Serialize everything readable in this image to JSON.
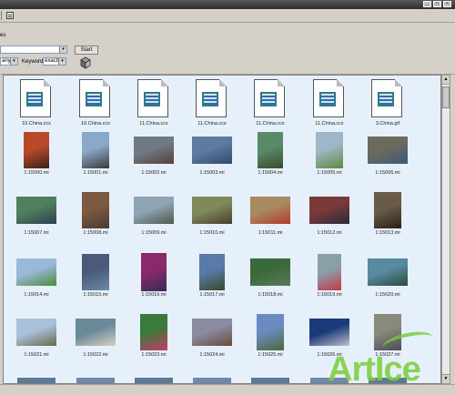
{
  "window": {
    "title_buttons": [
      "_",
      "□",
      "×"
    ]
  },
  "toolbar": {
    "row2_label": "es"
  },
  "search": {
    "start_label": "Start",
    "any_value": "any",
    "keyword_label": "Keyword",
    "match_value": "exactly"
  },
  "files": [
    {
      "label": "10.China.ccx"
    },
    {
      "label": "10.China.ccx"
    },
    {
      "label": "11.China.ccx"
    },
    {
      "label": "11.China.ccx"
    },
    {
      "label": "11.China.ccx"
    },
    {
      "label": "11.China.ccx"
    },
    {
      "label": "3.China.gif"
    }
  ],
  "thumbnails": [
    {
      "label": "1:15000.mi",
      "c1": "#b84a2a",
      "c2": "#3a2214"
    },
    {
      "label": "1:15001.mi",
      "c1": "#8aa8c8",
      "c2": "#3b3a36"
    },
    {
      "label": "1:15002.mi",
      "c1": "#6f7a86",
      "c2": "#5b4032"
    },
    {
      "label": "1:15003.mi",
      "c1": "#5f7aa0",
      "c2": "#2f4b6a"
    },
    {
      "label": "1:15004.mi",
      "c1": "#5a8a68",
      "c2": "#3b4a2e"
    },
    {
      "label": "1:15005.mi",
      "c1": "#9fb6c8",
      "c2": "#5e8a3a"
    },
    {
      "label": "1:15006.mi",
      "c1": "#6c6a5c",
      "c2": "#3a5a7a"
    },
    {
      "label": "1:15007.mi",
      "c1": "#4f7f5e",
      "c2": "#2e3f4f"
    },
    {
      "label": "1:15008.mi",
      "c1": "#7c5a42",
      "c2": "#4b3a2e"
    },
    {
      "label": "1:15009.mi",
      "c1": "#8fa5b6",
      "c2": "#4c5a4a"
    },
    {
      "label": "1:15010.mi",
      "c1": "#7e8a5a",
      "c2": "#4a3e2e"
    },
    {
      "label": "1:15011.mi",
      "c1": "#a88a62",
      "c2": "#b23a2a"
    },
    {
      "label": "1:15012.mi",
      "c1": "#7a3a3a",
      "c2": "#2a2a3a"
    },
    {
      "label": "1:15013.mi",
      "c1": "#6a5a4a",
      "c2": "#2a2016"
    },
    {
      "label": "1:15014.mi",
      "c1": "#9ab8d8",
      "c2": "#4a8a3a"
    },
    {
      "label": "1:15015.mi",
      "c1": "#4a5a7a",
      "c2": "#6a8aa0"
    },
    {
      "label": "1:15016.mi",
      "c1": "#8a2a6a",
      "c2": "#3a2a5a"
    },
    {
      "label": "1:15017.mi",
      "c1": "#5a7aa8",
      "c2": "#3a4a2a"
    },
    {
      "label": "1:15018.mi",
      "c1": "#3a6a3a",
      "c2": "#5a7a5a"
    },
    {
      "label": "1:15019.mi",
      "c1": "#8aa0a8",
      "c2": "#c23a4a"
    },
    {
      "label": "1:15020.mi",
      "c1": "#5a8aa0",
      "c2": "#2a4a3a"
    },
    {
      "label": "1:15021.mi",
      "c1": "#a8c0d8",
      "c2": "#6a6a4a"
    },
    {
      "label": "1:15022.mi",
      "c1": "#6a8a9a",
      "c2": "#d8d0c0"
    },
    {
      "label": "1:15023.mi",
      "c1": "#3a7a3a",
      "c2": "#c83a6a"
    },
    {
      "label": "1:15024.mi",
      "c1": "#8a8aa0",
      "c2": "#6a4a3a"
    },
    {
      "label": "1:15025.mi",
      "c1": "#6a8ac0",
      "c2": "#4a6a3a"
    },
    {
      "label": "1:15026.mi",
      "c1": "#1a3a7a",
      "c2": "#c0c0c8"
    },
    {
      "label": "1:15027.mi",
      "c1": "#8a8a7a",
      "c2": "#4a4a5a"
    }
  ],
  "watermark": {
    "text": "ArtIce"
  }
}
